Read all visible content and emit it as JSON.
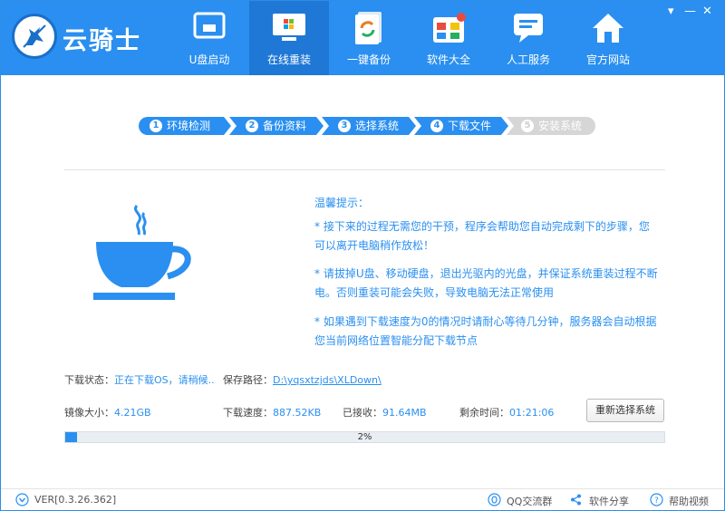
{
  "brand": {
    "name": "云骑士"
  },
  "nav": [
    {
      "label": "U盘启动",
      "icon": "usb-drive-icon"
    },
    {
      "label": "在线重装",
      "icon": "windows-monitor-icon"
    },
    {
      "label": "一键备份",
      "icon": "backup-icon"
    },
    {
      "label": "软件大全",
      "icon": "software-store-icon"
    },
    {
      "label": "人工服务",
      "icon": "chat-service-icon"
    },
    {
      "label": "官方网站",
      "icon": "home-icon"
    }
  ],
  "active_nav": "在线重装",
  "window_controls": {
    "dropdown": "▾",
    "minimize": "—",
    "close": "✕"
  },
  "steps": [
    {
      "num": "1",
      "label": "环境检测",
      "state": "done"
    },
    {
      "num": "2",
      "label": "备份资料",
      "state": "done"
    },
    {
      "num": "3",
      "label": "选择系统",
      "state": "done"
    },
    {
      "num": "4",
      "label": "下载文件",
      "state": "current"
    },
    {
      "num": "5",
      "label": "安装系统",
      "state": "pending"
    }
  ],
  "tips": {
    "title": "温馨提示：",
    "lines": [
      "* 接下来的过程无需您的干预，程序会帮助您自动完成剩下的步骤，您",
      "可以离开电脑稍作放松！",
      "* 请拔掉U盘、移动硬盘，退出光驱内的光盘，并保证系统重装过程不断",
      "电。否则重装可能会失败，导致电脑无法正常使用",
      "* 如果遇到下载速度为0的情况时请耐心等待几分钟，服务器会自动根据",
      "您当前网络位置智能分配下载节点"
    ]
  },
  "status": {
    "download_status_label": "下载状态：",
    "download_status_value": "正在下载OS，请稍候..",
    "save_path_label": "保存路径：",
    "save_path_value": "D:\\yqsxtzjds\\XLDown\\",
    "image_size_label": "镜像大小：",
    "image_size_value": "4.21GB",
    "speed_label": "下载速度：",
    "speed_value": "887.52KB",
    "received_label": "已接收：",
    "received_value": "91.64MB",
    "remaining_label": "剩余时间：",
    "remaining_value": "01:21:06",
    "reselect_button": "重新选择系统"
  },
  "progress": {
    "value": 0.02,
    "label": "2%"
  },
  "footer": {
    "version": "VER[0.3.26.362]",
    "qq": "QQ交流群",
    "share": "软件分享",
    "help": "帮助视频"
  },
  "colors": {
    "primary": "#2a8ff0",
    "active_nav": "#1f78d6",
    "step_disabled": "#d6d6d6"
  }
}
